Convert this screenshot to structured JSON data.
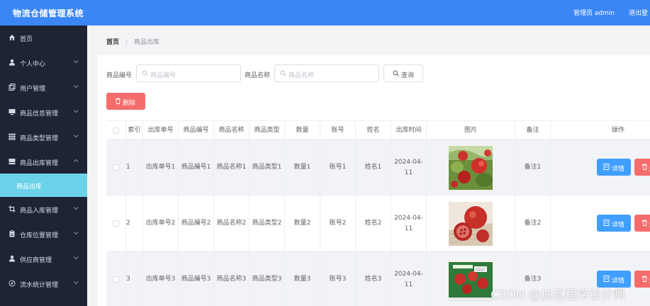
{
  "header": {
    "title": "物流仓储管理系统",
    "user": "管理员 admin",
    "logout": "退出登"
  },
  "sidebar": {
    "items": [
      {
        "label": "首页",
        "icon": "home-icon",
        "chevron": false
      },
      {
        "label": "个人中心",
        "icon": "user-icon",
        "chevron": true
      },
      {
        "label": "用户管理",
        "icon": "copy-icon",
        "chevron": true
      },
      {
        "label": "商品信息管理",
        "icon": "monitor-icon",
        "chevron": true
      },
      {
        "label": "商品类型管理",
        "icon": "grid-icon",
        "chevron": true
      },
      {
        "label": "商品出库管理",
        "icon": "box-icon",
        "chevron": true,
        "expanded": true
      },
      {
        "label": "商品入库管理",
        "icon": "crop-icon",
        "chevron": true
      },
      {
        "label": "仓库位置管理",
        "icon": "clipboard-icon",
        "chevron": true
      },
      {
        "label": "供应商管理",
        "icon": "user-icon",
        "chevron": true
      },
      {
        "label": "流水统计管理",
        "icon": "compass-icon",
        "chevron": true
      }
    ],
    "active_sub": "商品出库"
  },
  "breadcrumb": {
    "home": "首页",
    "separator": "/",
    "current": "商品出库"
  },
  "search": {
    "field1_label": "商品编号",
    "field1_placeholder": "商品编号",
    "field2_label": "商品名称",
    "field2_placeholder": "商品名称",
    "query_label": "查询"
  },
  "toolbar": {
    "delete_label": "删除"
  },
  "table": {
    "columns": [
      "索引",
      "出库单号",
      "商品编号",
      "商品名称",
      "商品类型",
      "数量",
      "账号",
      "姓名",
      "出库时间",
      "图片",
      "备注",
      "操作"
    ],
    "rows": [
      {
        "index": "1",
        "order_no": "出库单号1",
        "product_no": "商品编号1",
        "product_name": "商品名称1",
        "product_type": "商品类型1",
        "quantity": "数量1",
        "account": "账号1",
        "name": "姓名1",
        "time": "2024-04-11",
        "remark": "备注1",
        "image": "pomegranate-on-tree"
      },
      {
        "index": "2",
        "order_no": "出库单号2",
        "product_no": "商品编号2",
        "product_name": "商品名称2",
        "product_type": "商品类型2",
        "quantity": "数量2",
        "account": "账号2",
        "name": "姓名2",
        "time": "2024-04-11",
        "remark": "备注2",
        "image": "pomegranate-cut"
      },
      {
        "index": "3",
        "order_no": "出库单号3",
        "product_no": "商品编号3",
        "product_name": "商品名称3",
        "product_type": "商品类型3",
        "quantity": "数量3",
        "account": "账号3",
        "name": "姓名3",
        "time": "2024-04-11",
        "remark": "备注3",
        "image": "pomegranate-box"
      }
    ],
    "detail_label": "详情",
    "delete_label": "删除"
  },
  "watermark": "CSDN @加瓦程序设计师",
  "colors": {
    "primary": "#3b86f5",
    "sidebar": "#1f2435",
    "active": "#6ad3ea",
    "danger": "#f56c6c",
    "info": "#409eff"
  }
}
